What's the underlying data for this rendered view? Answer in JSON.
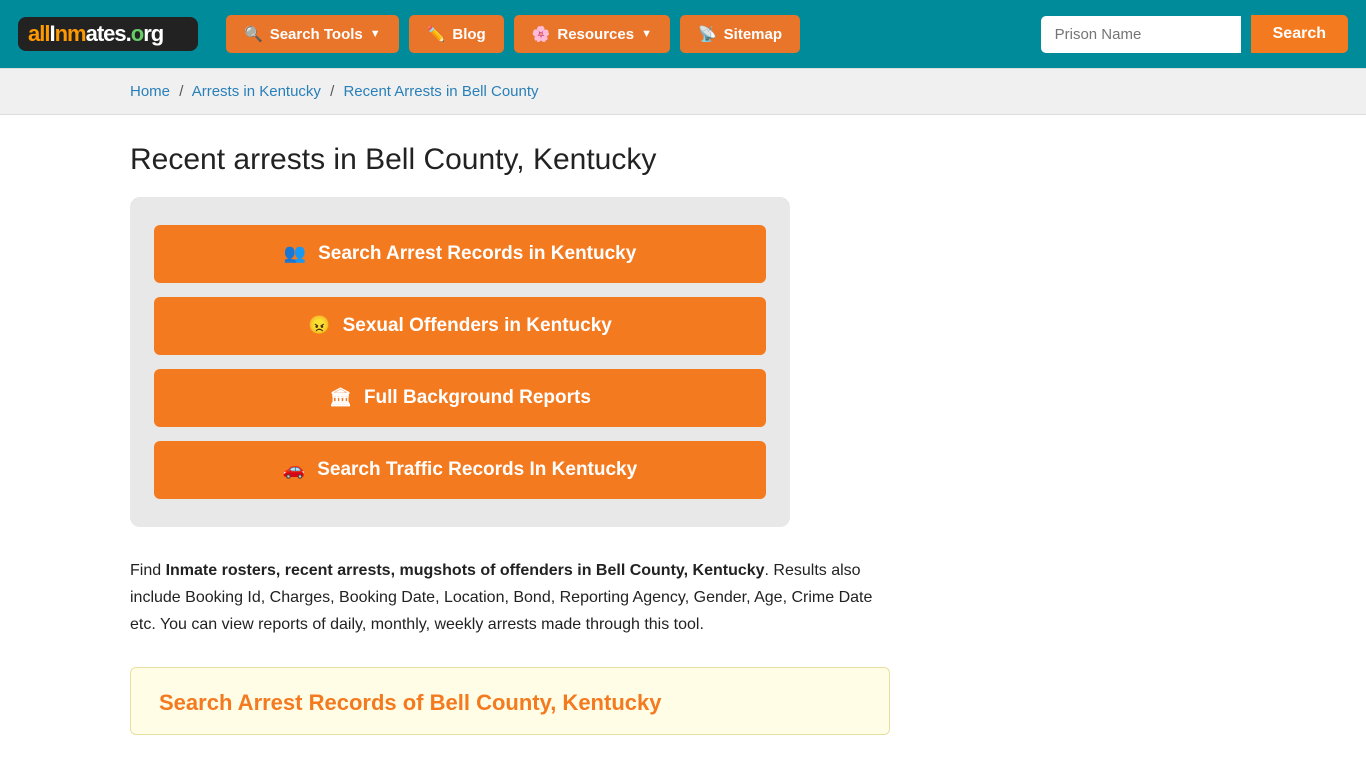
{
  "nav": {
    "logo_text": "allInmates.org",
    "search_tools_label": "Search Tools",
    "blog_label": "Blog",
    "resources_label": "Resources",
    "sitemap_label": "Sitemap",
    "search_placeholder": "Prison Name",
    "search_btn_label": "Search"
  },
  "breadcrumb": {
    "home": "Home",
    "arrests_in_kentucky": "Arrests in Kentucky",
    "recent_arrests": "Recent Arrests in Bell County"
  },
  "page": {
    "title": "Recent arrests in Bell County, Kentucky",
    "btn1": "Search Arrest Records in Kentucky",
    "btn2": "Sexual Offenders in Kentucky",
    "btn3": "Full Background Reports",
    "btn4": "Search Traffic Records In Kentucky",
    "desc_intro": "Find ",
    "desc_bold": "Inmate rosters, recent arrests, mugshots of offenders in Bell County, Kentucky",
    "desc_rest": ". Results also include Booking Id, Charges, Booking Date, Location, Bond, Reporting Agency, Gender, Age, Crime Date etc. You can view reports of daily, monthly, weekly arrests made through this tool.",
    "search_section_title": "Search Arrest Records of Bell County, Kentucky"
  }
}
